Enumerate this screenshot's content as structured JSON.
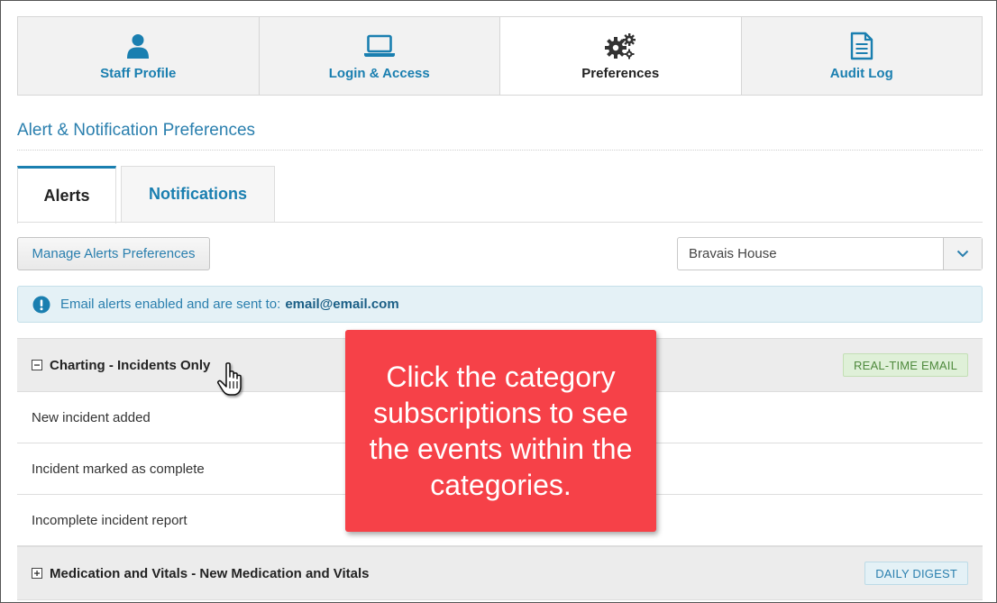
{
  "nav": {
    "tiles": [
      {
        "label": "Staff Profile",
        "icon": "user-icon"
      },
      {
        "label": "Login & Access",
        "icon": "laptop-icon"
      },
      {
        "label": "Preferences",
        "icon": "gears-icon"
      },
      {
        "label": "Audit Log",
        "icon": "document-icon"
      }
    ],
    "active": "Preferences"
  },
  "section": {
    "title": "Alert & Notification Preferences"
  },
  "tabs": [
    {
      "label": "Alerts",
      "active": true
    },
    {
      "label": "Notifications",
      "active": false
    }
  ],
  "toolbar": {
    "manage_label": "Manage Alerts Preferences",
    "location_select": {
      "value": "Bravais House"
    }
  },
  "info": {
    "text": "Email alerts enabled and are sent to:",
    "email": "email@email.com"
  },
  "categories": [
    {
      "name": "Charting - Incidents Only",
      "expanded": true,
      "badge": "REAL-TIME EMAIL",
      "events": [
        "New incident added",
        "Incident marked as complete",
        "Incomplete incident report"
      ]
    },
    {
      "name": "Medication and Vitals - New Medication and Vitals",
      "expanded": false,
      "badge": "DAILY DIGEST",
      "events": []
    }
  ],
  "callout": {
    "text": "Click the category subscriptions to see the events within the categories."
  },
  "colors": {
    "accent": "#1a7fb0",
    "callout": "#f64148",
    "badge_realtime": "#dff0d8",
    "badge_digest": "#e4f1f6"
  }
}
